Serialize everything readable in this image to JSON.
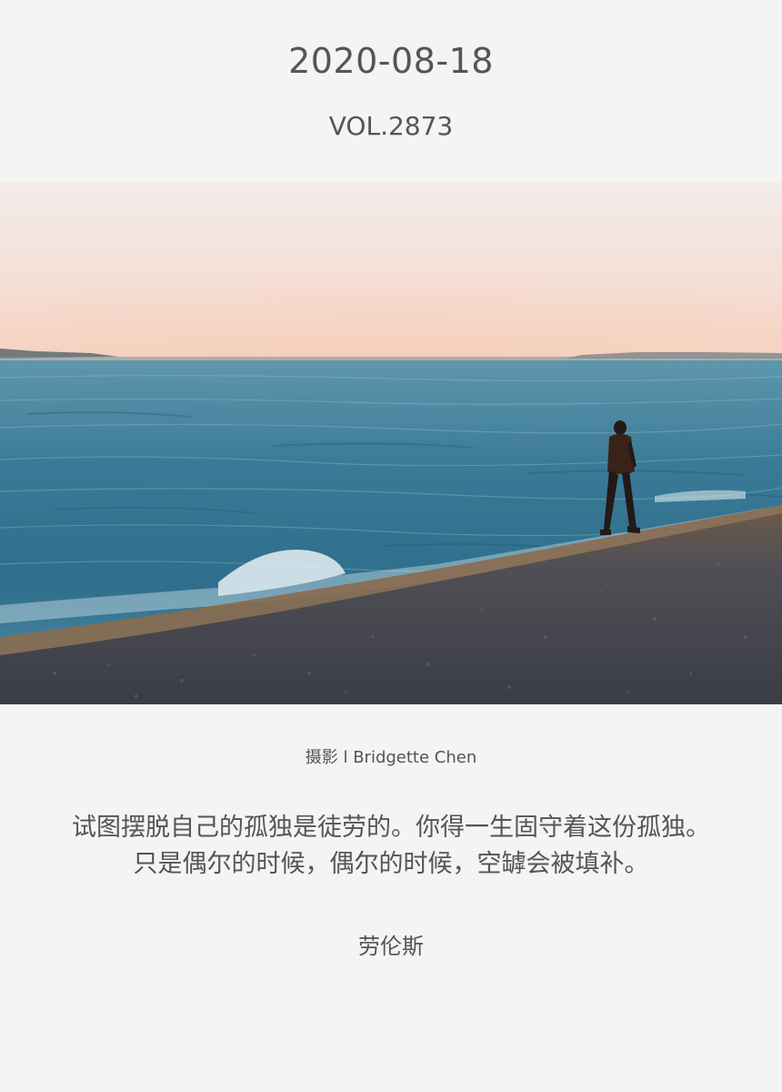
{
  "header": {
    "date": "2020-08-18",
    "volume": "VOL.2873"
  },
  "photo": {
    "description_icon": "photo-image"
  },
  "credit": "摄影 l Bridgette Chen",
  "quote": {
    "line1": "试图摆脱自己的孤独是徒劳的。你得一生固守着这份孤独。",
    "line2": "只是偶尔的时候，偶尔的时候，空罅会被填补。"
  },
  "author": "劳伦斯",
  "colors": {
    "background": "#f4f4f4",
    "text": "#555555",
    "sky_top": "#f1ebe9",
    "sky_horizon": "#f5d4c4",
    "sea": "#3f7f99",
    "sand": "#4b4d55"
  }
}
